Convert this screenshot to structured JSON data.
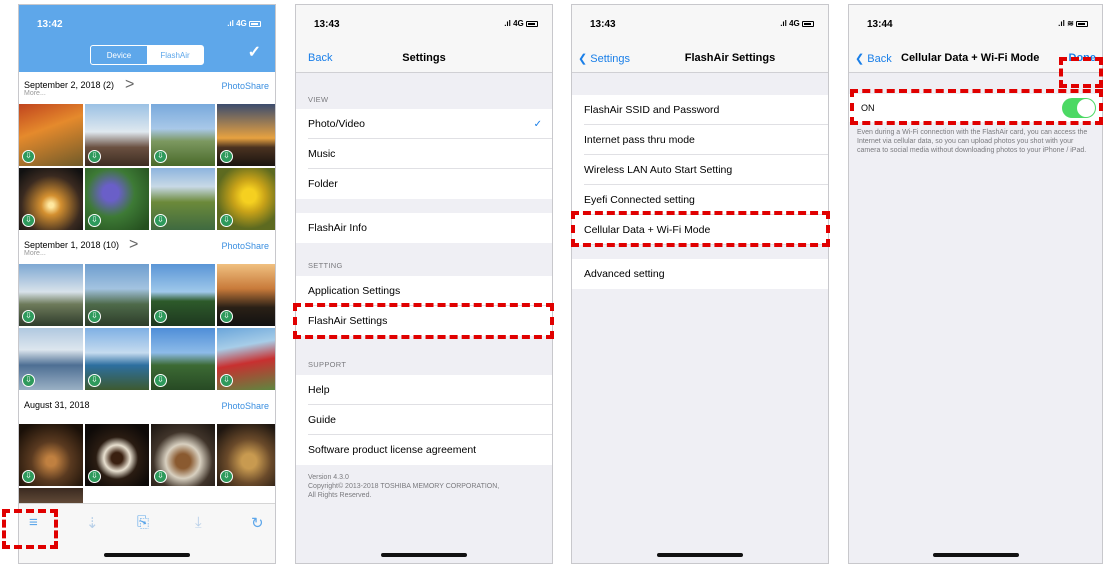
{
  "phone1": {
    "time": "13:42",
    "signal": ".ıl 4G",
    "segment": [
      "Device",
      "FlashAir"
    ],
    "check": "✓",
    "groups": [
      {
        "date": "September 2, 2018 (2)",
        "more": "More...",
        "chev": ">",
        "share": "PhotoShare"
      },
      {
        "date": "September 1, 2018 (10)",
        "more": "More...",
        "chev": ">",
        "share": "PhotoShare"
      },
      {
        "date": "August 31, 2018",
        "share": "PhotoShare"
      }
    ],
    "download_glyph": "⇩",
    "toolbar": {
      "menu": "≡",
      "sort": "⇣",
      "select": "⎘",
      "download": "⤓",
      "refresh": "↻"
    }
  },
  "phone2": {
    "time": "13:43",
    "signal": ".ıl 4G",
    "back": "Back",
    "title": "Settings",
    "view_header": "VIEW",
    "view_items": [
      "Photo/Video",
      "Music",
      "Folder"
    ],
    "check": "✓",
    "info": "FlashAir Info",
    "setting_header": "SETTING",
    "setting_items": [
      "Application Settings",
      "FlashAir Settings"
    ],
    "support_header": "SUPPORT",
    "support_items": [
      "Help",
      "Guide",
      "Software product license agreement"
    ],
    "version": "Version 4.3.0",
    "copyright": "Copyright© 2013-2018 TOSHIBA MEMORY CORPORATION, All Rights Reserved."
  },
  "phone3": {
    "time": "13:43",
    "signal": ".ıl 4G",
    "back": "Settings",
    "title": "FlashAir Settings",
    "items": [
      "FlashAir SSID and Password",
      "Internet pass thru mode",
      "Wireless LAN Auto Start Setting",
      "Eyefi Connected setting",
      "Cellular Data + Wi-Fi Mode",
      "Advanced setting"
    ]
  },
  "phone4": {
    "time": "13:44",
    "signal": ".ıl ≋",
    "back": "Back",
    "title": "Cellular Data + Wi-Fi Mode",
    "done": "Done",
    "on_label": "ON",
    "toggle_on": true,
    "description": "Even during a Wi-Fi connection with the FlashAir card, you can access the Internet via cellular data, so you can upload photos you shot with your camera to social media without downloading photos to your iPhone / iPad."
  },
  "colors": {
    "accent": "#1a7fe8",
    "header": "#5ea7ea",
    "highlight": "#e00000",
    "toggle": "#4cd964",
    "download": "#2e9a5c"
  }
}
